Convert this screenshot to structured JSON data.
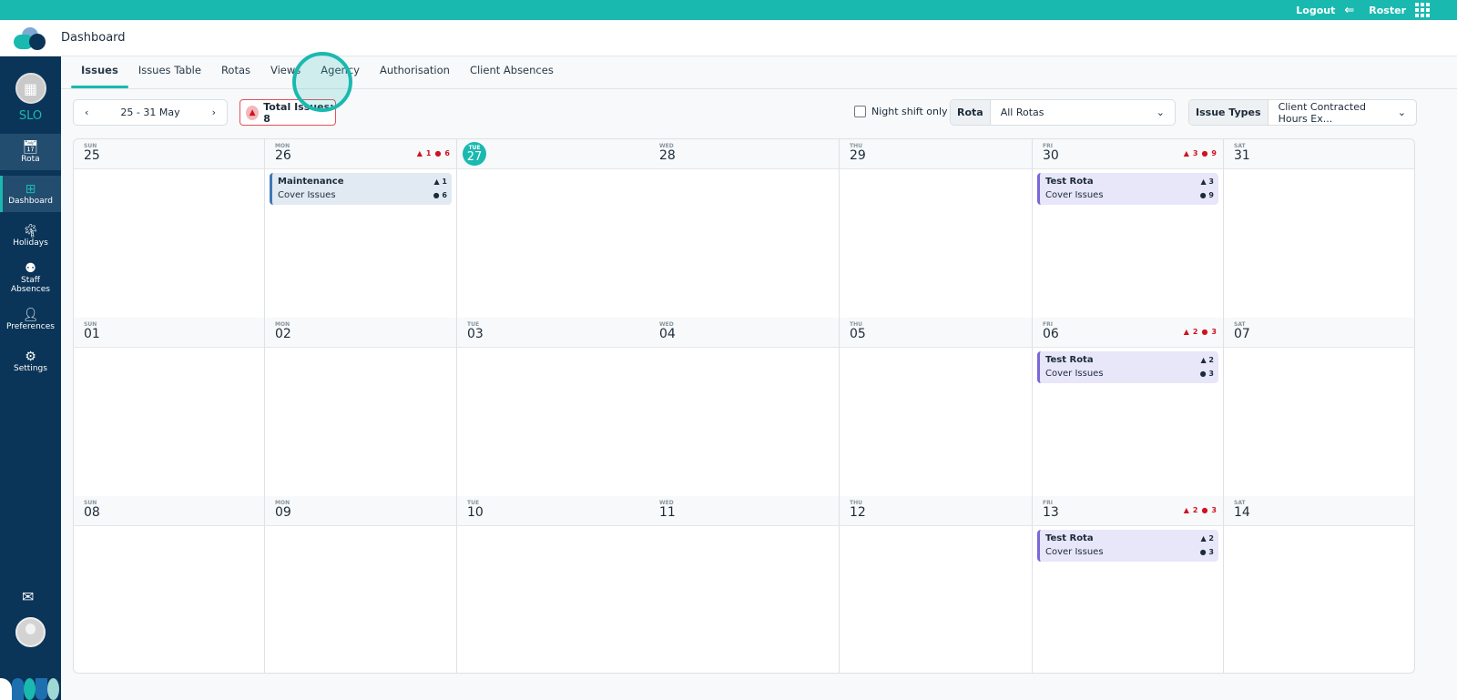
{
  "topbar": {
    "logout": "Logout",
    "roster": "Roster"
  },
  "header": {
    "title": "Dashboard"
  },
  "sidebar": {
    "org": "SLO",
    "items": [
      {
        "label": "Rota",
        "icon": "calendar-check"
      },
      {
        "label": "Dashboard",
        "icon": "layout-grid"
      },
      {
        "label": "Holidays",
        "icon": "palm-tree"
      },
      {
        "label": "Staff Absences",
        "icon": "users-off"
      },
      {
        "label": "Preferences",
        "icon": "user-cog"
      },
      {
        "label": "Settings",
        "icon": "gear"
      }
    ]
  },
  "tabs": [
    "Issues",
    "Issues Table",
    "Rotas",
    "Views",
    "Agency",
    "Authorisation",
    "Client Absences"
  ],
  "toolbar": {
    "range": "25 - 31 May",
    "total": "Total Issues: 8",
    "night": "Night shift only",
    "rota_label": "Rota",
    "rota_value": "All Rotas",
    "types_label": "Issue Types",
    "types_value": "Client Contracted Hours Ex..."
  },
  "colors": {
    "accent": "#1ab9b0",
    "navy": "#0b3558",
    "alert": "#d0111f"
  },
  "weeks": [
    [
      {
        "dow": "SUN",
        "date": "25"
      },
      {
        "dow": "MON",
        "date": "26",
        "warn": "1",
        "clock": "6",
        "cards": [
          {
            "title": "Maintenance",
            "sub": "Cover Issues",
            "warn": "1",
            "clock": "6",
            "bg": "#e1eaf3",
            "bar": "#3f77b5"
          }
        ]
      },
      {
        "dow": "TUE",
        "date": "27",
        "today": true
      },
      {
        "dow": "WED",
        "date": "28"
      },
      {
        "dow": "THU",
        "date": "29"
      },
      {
        "dow": "FRI",
        "date": "30",
        "warn": "3",
        "clock": "9",
        "cards": [
          {
            "title": "Test Rota",
            "sub": "Cover Issues",
            "warn": "3",
            "clock": "9",
            "bg": "#e8e6f9",
            "bar": "#7b67d8"
          }
        ]
      },
      {
        "dow": "SAT",
        "date": "31"
      }
    ],
    [
      {
        "dow": "SUN",
        "date": "01"
      },
      {
        "dow": "MON",
        "date": "02"
      },
      {
        "dow": "TUE",
        "date": "03"
      },
      {
        "dow": "WED",
        "date": "04"
      },
      {
        "dow": "THU",
        "date": "05"
      },
      {
        "dow": "FRI",
        "date": "06",
        "warn": "2",
        "clock": "3",
        "cards": [
          {
            "title": "Test Rota",
            "sub": "Cover Issues",
            "warn": "2",
            "clock": "3",
            "bg": "#e8e6f9",
            "bar": "#7b67d8"
          }
        ]
      },
      {
        "dow": "SAT",
        "date": "07"
      }
    ],
    [
      {
        "dow": "SUN",
        "date": "08"
      },
      {
        "dow": "MON",
        "date": "09"
      },
      {
        "dow": "TUE",
        "date": "10"
      },
      {
        "dow": "WED",
        "date": "11"
      },
      {
        "dow": "THU",
        "date": "12"
      },
      {
        "dow": "FRI",
        "date": "13",
        "warn": "2",
        "clock": "3",
        "cards": [
          {
            "title": "Test Rota",
            "sub": "Cover Issues",
            "warn": "2",
            "clock": "3",
            "bg": "#e8e6f9",
            "bar": "#7b67d8"
          }
        ]
      },
      {
        "dow": "SAT",
        "date": "14"
      }
    ]
  ]
}
